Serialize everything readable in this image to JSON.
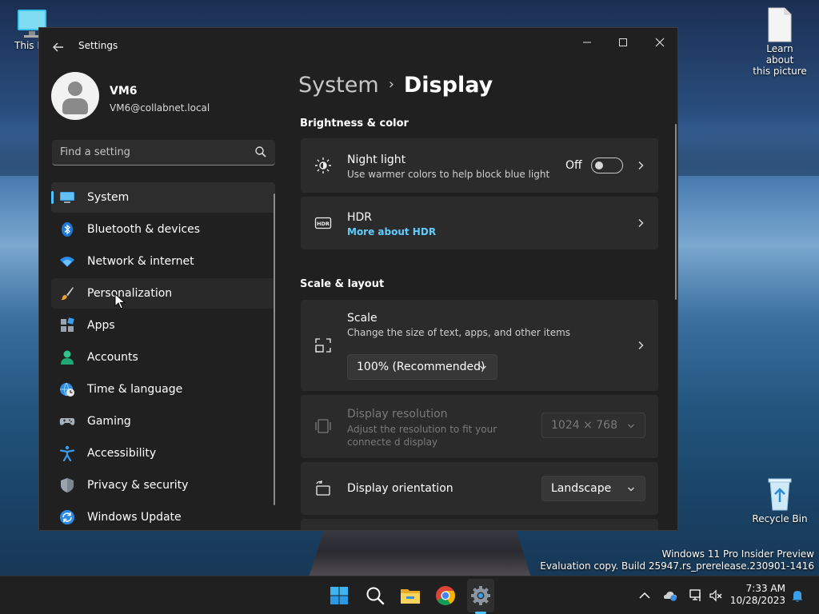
{
  "desktop": {
    "this_pc_label": "This PC",
    "learn_label_line1": "Learn about",
    "learn_label_line2": "this picture",
    "recycle_bin_label": "Recycle Bin",
    "watermark_line1": "Windows 11 Pro Insider Preview",
    "watermark_line2": "Evaluation copy. Build 25947.rs_prerelease.230901-1416"
  },
  "window": {
    "title": "Settings",
    "minimize_glyph": "—",
    "maximize_glyph": "☐",
    "close_glyph": "✕"
  },
  "profile": {
    "name": "VM6",
    "email": "VM6@collabnet.local"
  },
  "search": {
    "placeholder": "Find a setting"
  },
  "sidebar": {
    "items": [
      {
        "label": "System",
        "icon": "monitor-icon"
      },
      {
        "label": "Bluetooth & devices",
        "icon": "bluetooth-icon"
      },
      {
        "label": "Network & internet",
        "icon": "wifi-icon"
      },
      {
        "label": "Personalization",
        "icon": "brush-icon"
      },
      {
        "label": "Apps",
        "icon": "apps-icon"
      },
      {
        "label": "Accounts",
        "icon": "person-icon"
      },
      {
        "label": "Time & language",
        "icon": "globe-clock-icon"
      },
      {
        "label": "Gaming",
        "icon": "gamepad-icon"
      },
      {
        "label": "Accessibility",
        "icon": "accessibility-icon"
      },
      {
        "label": "Privacy & security",
        "icon": "shield-icon"
      },
      {
        "label": "Windows Update",
        "icon": "update-icon"
      }
    ]
  },
  "breadcrumb": {
    "parent": "System",
    "separator": "›",
    "current": "Display"
  },
  "sections": {
    "brightness": "Brightness & color",
    "scale_layout": "Scale & layout"
  },
  "night_light": {
    "title": "Night light",
    "subtitle": "Use warmer colors to help block blue light",
    "state": "Off"
  },
  "hdr": {
    "title": "HDR",
    "link": "More about HDR"
  },
  "scale": {
    "title": "Scale",
    "subtitle": "Change the size of text, apps, and other items",
    "value": "100% (Recommended)"
  },
  "resolution": {
    "title": "Display resolution",
    "subtitle": "Adjust the resolution to fit your connecte d display",
    "value": "1024 × 768"
  },
  "orientation": {
    "title": "Display orientation",
    "value": "Landscape"
  },
  "taskbar": {
    "time": "7:33 AM",
    "date": "10/28/2023"
  },
  "colors": {
    "accent": "#4cc2ff",
    "link": "#60cdff",
    "window_bg": "#202020",
    "card_bg": "#2b2b2b"
  }
}
